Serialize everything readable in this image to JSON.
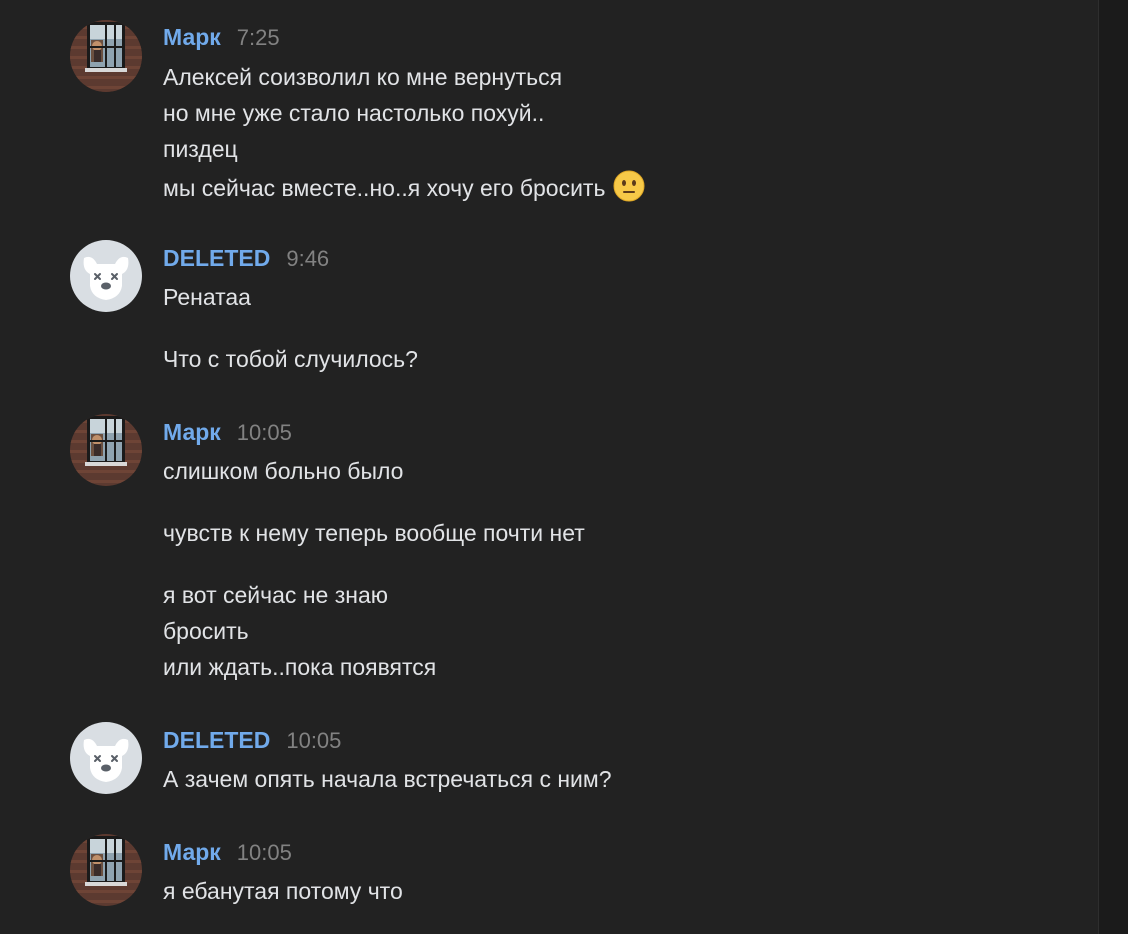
{
  "messages": [
    {
      "author": "Марк",
      "time": "7:25",
      "avatar": "photo-avatar",
      "lines": [
        "Алексей соизволил ко мне вернуться",
        "но мне уже стало настолько похуй..",
        "пиздец",
        "мы сейчас вместе..но..я хочу его бросить"
      ],
      "emoji": "neutral-face-emoji"
    },
    {
      "author": "DELETED",
      "time": "9:46",
      "avatar": "deleted-dog-avatar",
      "lines": [
        "Ренатаа",
        "Что с тобой случилось?"
      ]
    },
    {
      "author": "Марк",
      "time": "10:05",
      "avatar": "photo-avatar",
      "lines": [
        "слишком больно было",
        "чувств к нему теперь вообще почти нет",
        "я вот сейчас не знаю",
        "бросить",
        "или ждать..пока появятся"
      ]
    },
    {
      "author": "DELETED",
      "time": "10:05",
      "avatar": "deleted-dog-avatar",
      "lines": [
        "А зачем опять начала встречаться с ним?"
      ]
    },
    {
      "author": "Марк",
      "time": "10:05",
      "avatar": "photo-avatar",
      "lines": [
        "я ебанутая потому что"
      ]
    }
  ],
  "colors": {
    "background": "#222222",
    "author": "#71aaeb",
    "time": "#828282",
    "text": "#e1e3e6"
  }
}
